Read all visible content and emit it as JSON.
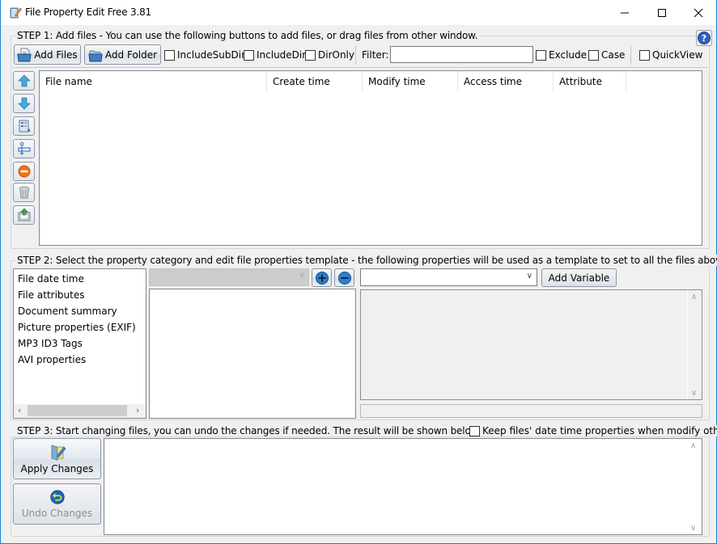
{
  "window": {
    "title": "File Property Edit Free 3.81",
    "controls": {
      "minimize": "minimize",
      "maximize": "maximize",
      "close": "close"
    }
  },
  "step1": {
    "legend": "STEP 1: Add files - You can use the following buttons to add files, or drag files from other window.",
    "add_files_label": "Add Files",
    "add_folder_label": "Add Folder",
    "include_subdir_label": "IncludeSubDir",
    "include_subdir_checked": false,
    "include_dir_label": "IncludeDir",
    "include_dir_checked": false,
    "dir_only_label": "DirOnly",
    "dir_only_checked": false,
    "filter_label": "Filter:",
    "filter_value": "",
    "exclude_label": "Exclude",
    "exclude_checked": false,
    "case_label": "Case",
    "case_checked": false,
    "quickview_label": "QuickView",
    "quickview_checked": false,
    "help_icon": "help-icon",
    "side_tools": [
      {
        "name": "move-up",
        "icon": "arrow-up-icon"
      },
      {
        "name": "move-down",
        "icon": "arrow-down-icon"
      },
      {
        "name": "properties",
        "icon": "properties-icon"
      },
      {
        "name": "rename",
        "icon": "rename-icon"
      },
      {
        "name": "remove",
        "icon": "remove-icon"
      },
      {
        "name": "clear",
        "icon": "trash-icon"
      },
      {
        "name": "export",
        "icon": "export-icon"
      }
    ],
    "file_table": {
      "columns": [
        "File name",
        "Create time",
        "Modify time",
        "Access time",
        "Attribute"
      ],
      "rows": []
    }
  },
  "step2": {
    "legend": "STEP 2: Select the property category and edit file properties template - the following properties will be used as a template to set to all the files above.",
    "categories": [
      "File date time",
      "File attributes",
      "Document summary",
      "Picture properties (EXIF)",
      "MP3 ID3 Tags",
      "AVI properties"
    ],
    "property_select_value": "",
    "variable_select_value": "",
    "add_variable_label": "Add Variable"
  },
  "step3": {
    "legend": "STEP 3: Start changing files, you can undo the changes if needed. The result will be shown below.",
    "keep_datetime_label": "Keep files' date time properties when modify others",
    "keep_datetime_checked": false,
    "apply_label": "Apply Changes",
    "undo_label": "Undo Changes",
    "result_text": ""
  }
}
